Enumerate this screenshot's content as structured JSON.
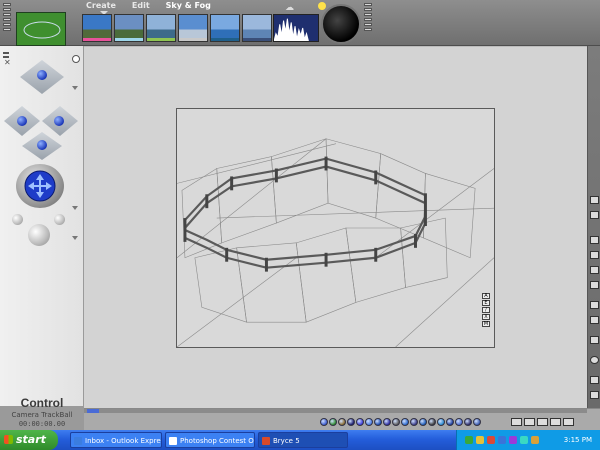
{
  "menus": [
    {
      "label": "Create",
      "active": false
    },
    {
      "label": "Edit",
      "active": false
    },
    {
      "label": "Sky & Fog",
      "active": true
    }
  ],
  "sky_presets": [
    {
      "name": "preset-1",
      "sky": "#3a78c6",
      "ground": "#516a3a",
      "bar": "#e8539a"
    },
    {
      "name": "preset-2",
      "sky": "#6b8fc2",
      "ground": "#4a6b3a",
      "bar": "#9dd6ea"
    },
    {
      "name": "preset-3",
      "sky": "#8fb2d8",
      "ground": "#3d6b8a",
      "bar": "#8fc552"
    },
    {
      "name": "preset-4",
      "sky": "#5a8ed0",
      "ground": "#b8c7d8",
      "bar": "#c9c9c9"
    },
    {
      "name": "preset-5",
      "sky": "#7aa9e0",
      "ground": "#2f6fb8",
      "bar": "#1f5f8a"
    },
    {
      "name": "preset-6",
      "sky": "#9bb8dc",
      "ground": "#5e85b5",
      "bar": "#3a4f78"
    }
  ],
  "left_panel": {
    "title": "Control",
    "subtitle": "Camera TrackBall",
    "time": "00:00:00.00"
  },
  "taskbar": {
    "start_label": "start",
    "tasks": [
      {
        "label": "Inbox - Outlook Express",
        "icon_color": "#3b7de0",
        "active": false
      },
      {
        "label": "Photoshop Contest O...",
        "icon_color": "#ffffff",
        "active": false
      },
      {
        "label": "Bryce 5",
        "icon_color": "#d84a2a",
        "active": true
      }
    ],
    "clock": "3:15 PM"
  },
  "icons": {
    "start_logo": "windows-flag-icon",
    "sun": "sun-icon",
    "cloud": "cloud-icon"
  },
  "colors": {
    "accent_blue": "#1a36b8",
    "taskbar_blue": "#245edb",
    "start_green": "#2f8b2a"
  }
}
